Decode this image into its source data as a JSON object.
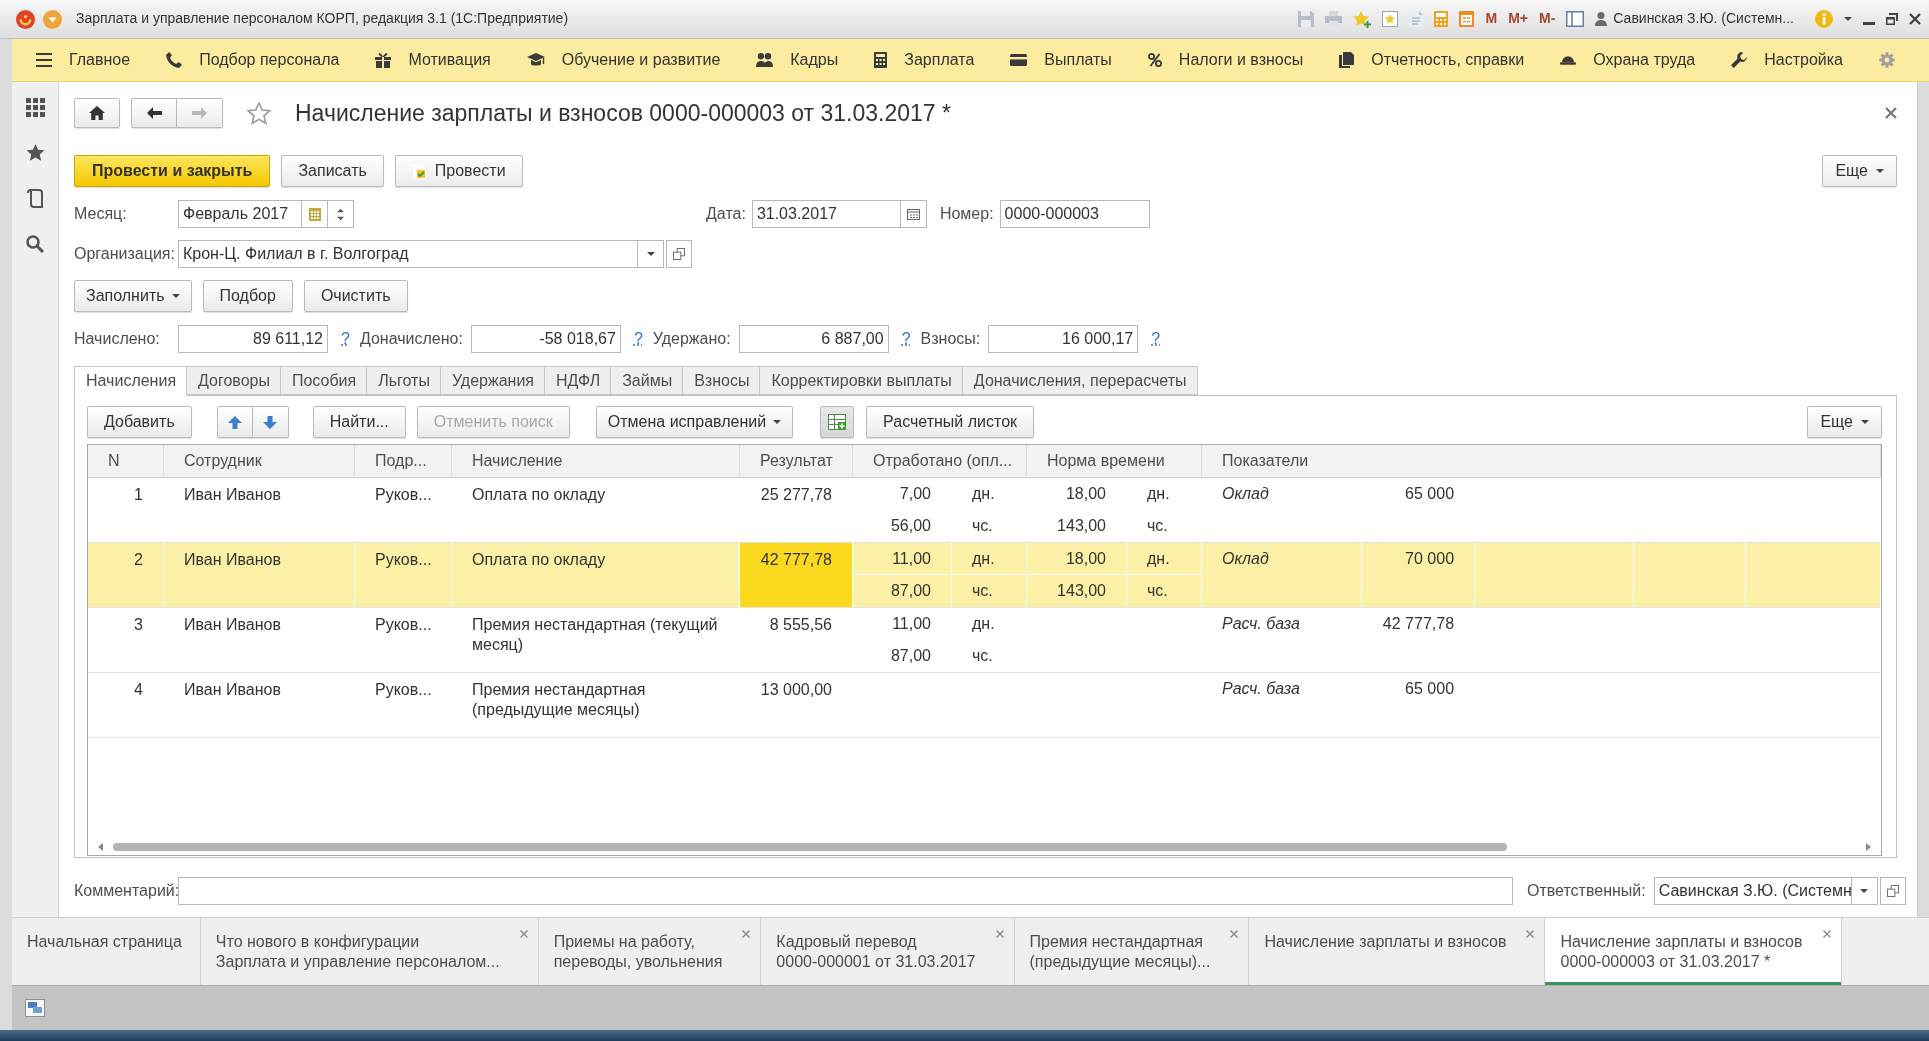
{
  "window": {
    "title": "Зарплата и управление персоналом КОРП, редакция 3.1 (1С:Предприятие)",
    "memory_buttons": [
      "M",
      "M+",
      "M-"
    ],
    "user": "Савинская З.Ю. (Системн..."
  },
  "menu": [
    {
      "label": "Главное"
    },
    {
      "label": "Подбор персонала"
    },
    {
      "label": "Мотивация"
    },
    {
      "label": "Обучение и развитие"
    },
    {
      "label": "Кадры"
    },
    {
      "label": "Зарплата"
    },
    {
      "label": "Выплаты"
    },
    {
      "label": "Налоги и взносы"
    },
    {
      "label": "Отчетность, справки"
    },
    {
      "label": "Охрана труда"
    },
    {
      "label": "Настройка"
    }
  ],
  "form": {
    "nav_buttons": [
      {
        "kind": "home",
        "disabled": false
      },
      {
        "kind": "back",
        "disabled": false
      },
      {
        "kind": "forward",
        "disabled": true
      }
    ],
    "favorite": false,
    "title": "Начисление зарплаты и взносов 0000-000003 от 31.03.2017 *",
    "commands": [
      {
        "kind": "primary",
        "label": "Провести и закрыть"
      },
      {
        "kind": "plain",
        "label": "Записать"
      },
      {
        "kind": "post",
        "label": "Провести"
      }
    ],
    "more": "Еще",
    "month": {
      "label": "Месяц:",
      "value": "Февраль 2017"
    },
    "date": {
      "label": "Дата:",
      "value": "31.03.2017"
    },
    "number": {
      "label": "Номер:",
      "value": "0000-000003"
    },
    "organization": {
      "label": "Организация:",
      "value": "Крон-Ц. Филиал в г. Волгоград"
    },
    "fill_buttons": [
      {
        "label": "Заполнить",
        "dropdown": true
      },
      {
        "label": "Подбор",
        "dropdown": false
      },
      {
        "label": "Очистить",
        "dropdown": false
      }
    ],
    "totals": [
      {
        "label": "Начислено:",
        "value": "89 611,12",
        "help": "?"
      },
      {
        "label": "Доначислено:",
        "value": "-58 018,67",
        "help": "?"
      },
      {
        "label": "Удержано:",
        "value": "6 887,00",
        "help": "?"
      },
      {
        "label": "Взносы:",
        "value": "16 000,17",
        "help": "?"
      }
    ],
    "tabs": [
      {
        "label": "Начисления",
        "selected": true
      },
      {
        "label": "Договоры",
        "selected": false
      },
      {
        "label": "Пособия",
        "selected": false
      },
      {
        "label": "Льготы",
        "selected": false
      },
      {
        "label": "Удержания",
        "selected": false
      },
      {
        "label": "НДФЛ",
        "selected": false
      },
      {
        "label": "Займы",
        "selected": false
      },
      {
        "label": "Взносы",
        "selected": false
      },
      {
        "label": "Корректировки выплаты",
        "selected": false
      },
      {
        "label": "Доначисления, перерасчеты",
        "selected": false
      }
    ],
    "toolbar": {
      "items": [
        {
          "kind": "button",
          "label": "Добавить",
          "disabled": false
        },
        {
          "kind": "move",
          "disabled": false
        },
        {
          "kind": "button",
          "label": "Найти...",
          "disabled": false
        },
        {
          "kind": "button",
          "label": "Отменить поиск",
          "disabled": true
        },
        {
          "kind": "dropdown",
          "label": "Отмена исправлений",
          "disabled": false
        },
        {
          "kind": "table_icon",
          "disabled": false
        },
        {
          "kind": "button",
          "label": "Расчетный листок",
          "disabled": false
        }
      ],
      "more": "Еще"
    },
    "table": {
      "columns": [
        "N",
        "Сотрудник",
        "Подр...",
        "Начисление",
        "Результат",
        "Отработано (опл...",
        "Норма времени",
        "Показатели"
      ],
      "rows": [
        {
          "selected": false,
          "result_focused": false,
          "n": "1",
          "employee": "Иван Иванов",
          "department": "Руков...",
          "accrual": "Оплата по окладу",
          "result": "25 277,78",
          "worked": [
            {
              "value": "7,00",
              "unit": "дн."
            },
            {
              "value": "56,00",
              "unit": "чс."
            }
          ],
          "norm": [
            {
              "value": "18,00",
              "unit": "дн."
            },
            {
              "value": "143,00",
              "unit": "чс."
            }
          ],
          "indicators": [
            {
              "name": "Оклад",
              "value": "65 000"
            }
          ]
        },
        {
          "selected": true,
          "result_focused": true,
          "n": "2",
          "employee": "Иван Иванов",
          "department": "Руков...",
          "accrual": "Оплата по окладу",
          "result": "42 777,78",
          "worked": [
            {
              "value": "11,00",
              "unit": "дн."
            },
            {
              "value": "87,00",
              "unit": "чс."
            }
          ],
          "norm": [
            {
              "value": "18,00",
              "unit": "дн."
            },
            {
              "value": "143,00",
              "unit": "чс."
            }
          ],
          "indicators": [
            {
              "name": "Оклад",
              "value": "70 000"
            }
          ]
        },
        {
          "selected": false,
          "result_focused": false,
          "n": "3",
          "employee": "Иван Иванов",
          "department": "Руков...",
          "accrual": "Премия нестандартная (текущий месяц)",
          "result": "8 555,56",
          "worked": [
            {
              "value": "11,00",
              "unit": "дн."
            },
            {
              "value": "87,00",
              "unit": "чс."
            }
          ],
          "indicators": [
            {
              "name": "Расч. база",
              "value": "42 777,78"
            }
          ]
        },
        {
          "selected": false,
          "result_focused": false,
          "n": "4",
          "employee": "Иван Иванов",
          "department": "Руков...",
          "accrual": "Премия нестандартная (предыдущие месяцы)",
          "result": "13 000,00",
          "indicators": [
            {
              "name": "Расч. база",
              "value": "65 000"
            }
          ]
        }
      ]
    },
    "comment": {
      "label": "Комментарий:"
    },
    "responsible": {
      "label": "Ответственный:",
      "value": "Савинская З.Ю. (Системн"
    }
  },
  "open_windows": [
    {
      "lines": [
        "Начальная страница"
      ],
      "closable": false,
      "selected": false
    },
    {
      "lines": [
        "Что нового в конфигурации",
        "Зарплата и управление персоналом..."
      ],
      "closable": true,
      "selected": false
    },
    {
      "lines": [
        "Приемы на работу,",
        "переводы, увольнения"
      ],
      "closable": true,
      "selected": false
    },
    {
      "lines": [
        "Кадровый перевод",
        "0000-000001 от 31.03.2017"
      ],
      "closable": true,
      "selected": false
    },
    {
      "lines": [
        "Премия нестандартная",
        "(предыдущие месяцы)..."
      ],
      "closable": true,
      "selected": false
    },
    {
      "lines": [
        "Начисление зарплаты и взносов"
      ],
      "closable": true,
      "selected": false
    },
    {
      "lines": [
        "Начисление зарплаты и взносов",
        "0000-000003 от 31.03.2017 *"
      ],
      "closable": true,
      "selected": true
    }
  ]
}
